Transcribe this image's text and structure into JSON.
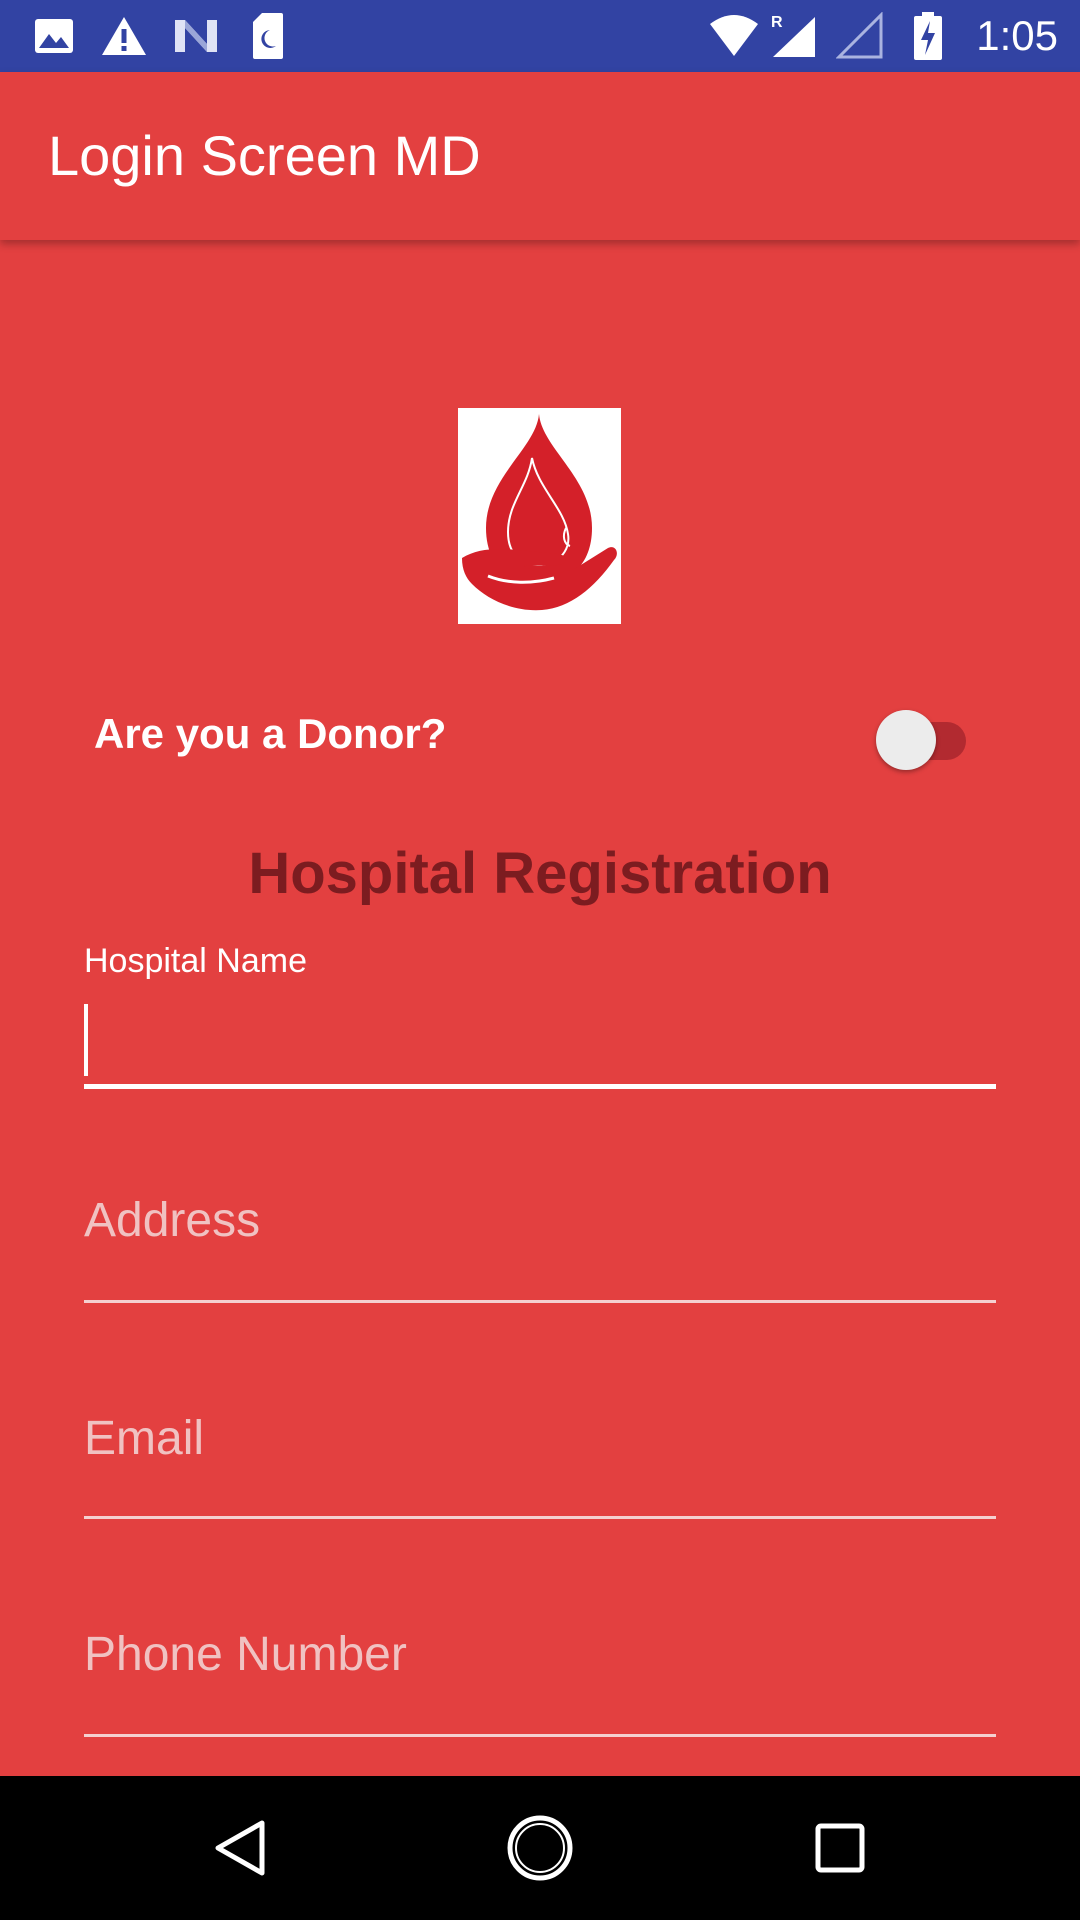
{
  "status_bar": {
    "time": "1:05",
    "left_icons": [
      "image-icon",
      "warning-icon",
      "n-notification-icon",
      "sim-card-icon"
    ],
    "right_icons": [
      "wifi-icon",
      "cell-signal-roaming-icon",
      "cell-signal-empty-icon",
      "battery-charging-icon"
    ],
    "roaming_mark": "R",
    "background": "#3243a3"
  },
  "app_bar": {
    "title": "Login Screen MD",
    "background": "#e34040"
  },
  "logo": {
    "icon": "blood-drop-hand-icon"
  },
  "donor_toggle": {
    "label": "Are you a Donor?",
    "checked": false
  },
  "form": {
    "heading": "Hospital Registration",
    "hospital_name": {
      "label": "Hospital Name",
      "value": ""
    },
    "address": {
      "placeholder": "Address",
      "value": ""
    },
    "email": {
      "placeholder": "Email",
      "value": ""
    },
    "phone": {
      "placeholder": "Phone Number",
      "value": ""
    }
  },
  "nav_bar": {
    "icons": [
      "back-icon",
      "home-icon",
      "recents-icon"
    ]
  },
  "colors": {
    "accent": "#e34040",
    "heading": "#7c1c20",
    "switch_track": "#b22a30",
    "logo_red": "#d42029"
  }
}
